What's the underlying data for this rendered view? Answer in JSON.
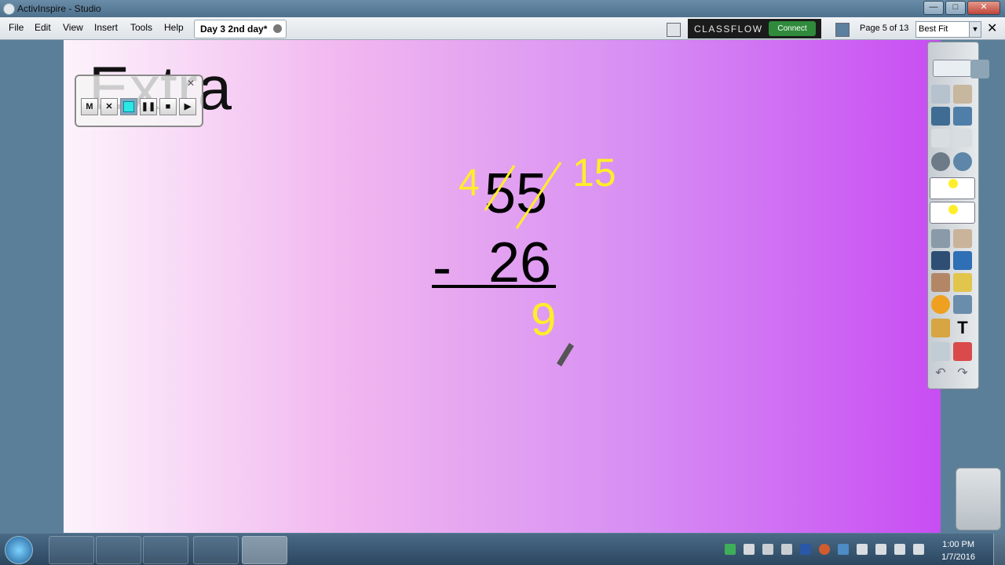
{
  "window": {
    "title": "ActivInspire - Studio",
    "minimize": "—",
    "maximize": "□",
    "close": "✕"
  },
  "menu": [
    "File",
    "Edit",
    "View",
    "Insert",
    "Tools",
    "Help"
  ],
  "doc_tab": {
    "label": "Day 3 2nd day*"
  },
  "classflow": {
    "brand": "CLASSFLOW",
    "connect": "Connect"
  },
  "page_info": "Page 5 of 13",
  "zoom": {
    "selected": "Best Fit"
  },
  "canvas": {
    "heading": "Extra",
    "problem": {
      "top": "55",
      "operator": "-",
      "bottom": "26"
    },
    "handwriting": {
      "crossed_tens": "4",
      "regrouped_ones": "15",
      "answer": "9"
    }
  },
  "recorder": {
    "buttons": [
      "M",
      "✕",
      "",
      "❚❚",
      "■",
      "▶"
    ],
    "close": "✕"
  },
  "taskbar": {
    "time": "1:00 PM",
    "date": "1/7/2016"
  },
  "colors": {
    "ink_yellow": "#ffee2a",
    "canvas_left": "#fdf3fb",
    "canvas_right": "#c84df3"
  },
  "icons": [
    "pen-icon",
    "highlighter-icon",
    "eraser-icon",
    "text-icon",
    "select-icon",
    "fill-icon",
    "shape-icon",
    "connector-icon",
    "clock-icon",
    "undo-icon",
    "redo-icon",
    "trash-icon"
  ]
}
